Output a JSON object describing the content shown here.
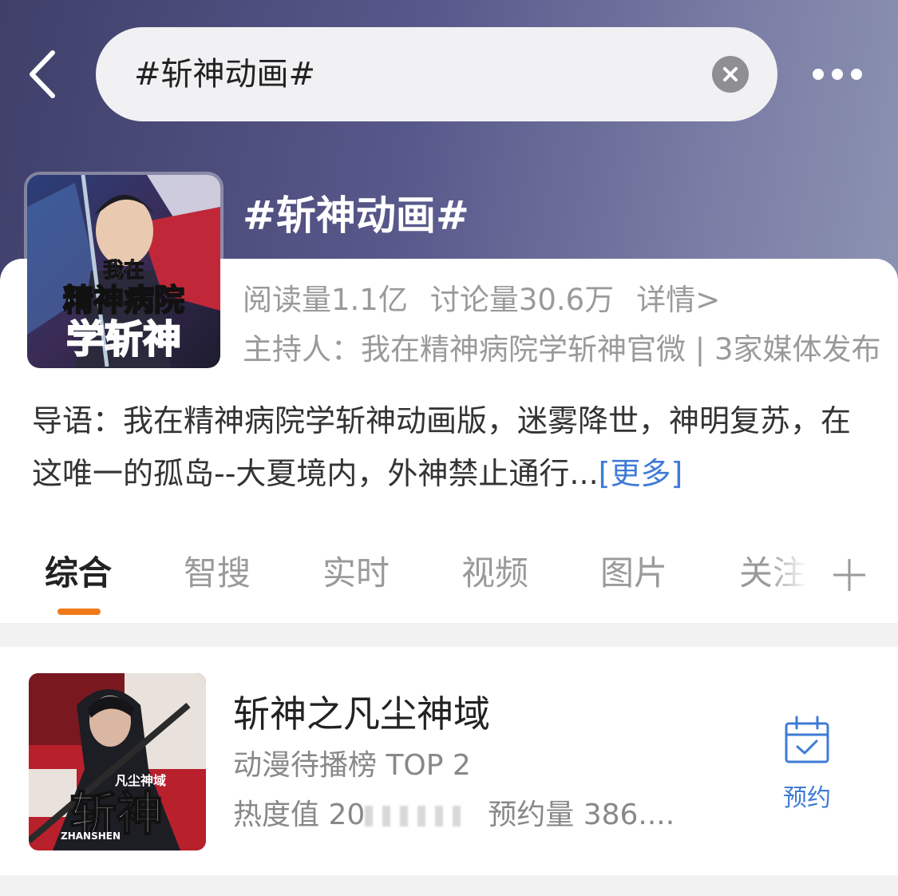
{
  "search": {
    "query": "#斩神动画#"
  },
  "topic": {
    "title": "#斩神动画#",
    "stats": {
      "reads": "阅读量1.1亿",
      "discussions": "讨论量30.6万",
      "details_link": "详情>"
    },
    "host_line": "主持人：我在精神病院学斩神官微 | 3家媒体发布",
    "intro_text": "导语：我在精神病院学斩神动画版，迷雾降世，神明复苏，在这唯一的孤岛--大夏境内，外神禁止通行...",
    "intro_more": "[更多]",
    "cover_text": {
      "line1": "我在",
      "line2": "精神病院",
      "line3": "学斩神"
    }
  },
  "tabs": [
    {
      "label": "综合",
      "active": true
    },
    {
      "label": "智搜"
    },
    {
      "label": "实时"
    },
    {
      "label": "视频"
    },
    {
      "label": "图片"
    },
    {
      "label": "关注"
    }
  ],
  "item": {
    "title": "斩神之凡尘神域",
    "rank": "动漫待播榜 TOP 2",
    "heat_prefix": "热度值 20",
    "reservations": "预约量 386....",
    "reserve_label": "预约",
    "poster_text": {
      "small": "凡尘神域",
      "big": "斩神",
      "latin": "ZHANSHEN"
    }
  },
  "colors": {
    "accent_orange": "#f07a1a",
    "link_blue": "#3f7bd6",
    "header_gradient_start": "#3f3f6a",
    "header_gradient_end": "#8c93b2"
  }
}
